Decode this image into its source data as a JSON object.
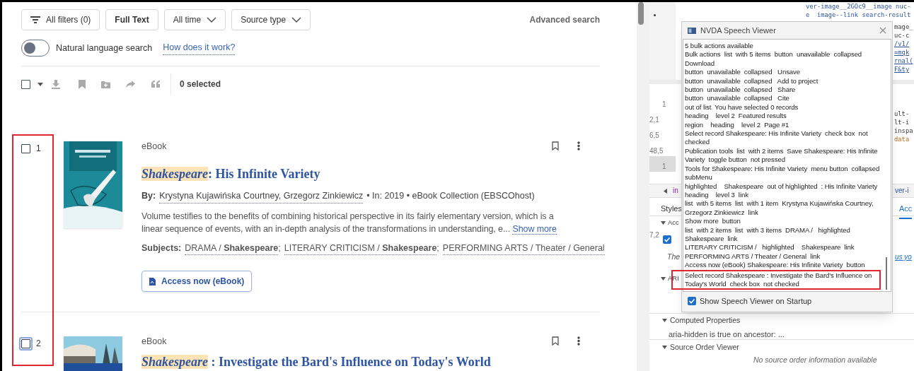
{
  "filters": [
    {
      "label": "All filters (0)",
      "kind": "filter"
    },
    {
      "label": "Full Text",
      "kind": "plain"
    },
    {
      "label": "All time",
      "kind": "dropdown"
    },
    {
      "label": "Source type",
      "kind": "dropdown"
    }
  ],
  "advanced_search": "Advanced search",
  "natural_language": {
    "label": "Natural language search",
    "on": false,
    "link": "How does it work?"
  },
  "bulk_toolbar": {
    "checked": false,
    "selected_count": "0 selected"
  },
  "results": [
    {
      "number": "1",
      "checked": false,
      "focused": false,
      "type": "eBook",
      "title_highlight": "Shakespeare",
      "title_rest": ": His Infinite Variety",
      "byline_label": "By:",
      "authors": "Krystyna Kujawińska Courtney, Grzegorz Zinkiewicz",
      "meta": "• In: 2019 • eBook Collection (EBSCOhost)",
      "abstract": "Volume testifies to the benefits of combining historical perspective in its fairly elementary version, which is a linear sequence of events, with an in-depth analysis of the transformations in understanding, e...",
      "show_more": "Show more",
      "subjects_label": "Subjects:",
      "subject_separator": ";",
      "subjects": [
        "DRAMA / **Shakespeare**",
        "LITERARY CRITICISM / **Shakespeare**",
        "PERFORMING ARTS / Theater / General"
      ],
      "access_button": "Access now (eBook)"
    },
    {
      "number": "2",
      "checked": false,
      "focused": true,
      "type": "eBook",
      "title_highlight": "Shakespeare",
      "title_rest": " : Investigate the Bard's Influence on Today's World"
    }
  ],
  "devtools": {
    "code_lines": [
      "ver-image__2GOc9__image nuc-",
      "e  image--link search-result"
    ],
    "code_fragments": [
      {
        "text": "mage_",
        "kind": "plain"
      },
      {
        "text": "uc-c",
        "kind": "plain"
      },
      {
        "text": "/v1/",
        "kind": "link"
      },
      {
        "text": "=mqk",
        "kind": "link"
      },
      {
        "text": "rnal(",
        "kind": "link"
      },
      {
        "text": "F&ty",
        "kind": "link"
      },
      {
        "text": "ult-",
        "kind": "plain"
      },
      {
        "text": "lt-i",
        "kind": "plain"
      },
      {
        "text": "inspa",
        "kind": "plain"
      },
      {
        "text": "data",
        "kind": "attr"
      }
    ],
    "gutter": [
      "1",
      "2,1",
      "6,5",
      "48,5",
      "1",
      "7,2"
    ],
    "breadcrumb": "in",
    "breadcrumb_tail": "ver-i",
    "tabs": [
      {
        "label": "Styles",
        "selected": false
      },
      {
        "label": "Acc",
        "selected": true
      }
    ],
    "sections": [
      {
        "label": "Acc",
        "expanded": true
      },
      {
        "label": "ARI",
        "expanded": true
      },
      {
        "label": "Computed Properties",
        "expanded": true
      },
      {
        "label": "Source Order Viewer",
        "expanded": true
      }
    ],
    "ignored_checked": true,
    "italic_text": "The",
    "link_fragment": "us yo",
    "computed_note": "aria-hidden is true on ancestor: ...",
    "source_order_note": "No source order information available"
  },
  "speech_viewer": {
    "title": "NVDA Speech Viewer",
    "lines": [
      {
        "text": "5 bulk actions available",
        "annotated": false
      },
      {
        "text": "Bulk actions  list  with 5 items  button  unavailable  collapsed",
        "annotated": false
      },
      {
        "text": "Download",
        "annotated": false
      },
      {
        "text": "button  unavailable  collapsed   Unsave",
        "annotated": false
      },
      {
        "text": "button  unavailable  collapsed   Add to project",
        "annotated": false
      },
      {
        "text": "button  unavailable  collapsed   Share",
        "annotated": false
      },
      {
        "text": "button  unavailable  collapsed   Cite",
        "annotated": false
      },
      {
        "text": "out of list  You have selected 0 records",
        "annotated": false
      },
      {
        "text": "heading    level 2  Featured results",
        "annotated": false
      },
      {
        "text": "region    heading    level 2  Page #1",
        "annotated": false
      },
      {
        "text": "Select record Shakespeare: His Infinite Variety  check box  not checked",
        "annotated": false
      },
      {
        "text": "Publication tools  list  with 2 items  Save Shakespeare: His Infinite Variety  toggle button  not pressed",
        "annotated": false
      },
      {
        "text": "Tools for Shakespeare: His Infinite Variety  menu button  collapsed  subMenu",
        "annotated": false
      },
      {
        "text": "highlighted    Shakespeare  out of highlighted  : His Infinite Variety  heading    level 3  link",
        "annotated": false
      },
      {
        "text": "list  with 5 items  list  with 1 item  Krystyna Kujawińska Courtney, Grzegorz Zinkiewicz  link",
        "annotated": false
      },
      {
        "text": "Show more  button",
        "annotated": false
      },
      {
        "text": "list  with 2 items  list  with 3 items  DRAMA /   highlighted    Shakespeare  link",
        "annotated": false
      },
      {
        "text": "LITERARY CRITICISM /   highlighted    Shakespeare  link",
        "annotated": false
      },
      {
        "text": "PERFORMING ARTS / Theater / General  link",
        "annotated": false
      },
      {
        "text": "Access now (eBook) Shakespeare: His Infinite Variety  button",
        "annotated": false
      },
      {
        "text": "Select record Shakespeare : Investigate the Bard's Influence on Today's World  check box  not checked",
        "annotated": true
      }
    ],
    "startup_label": "Show Speech Viewer on Startup",
    "startup_checked": true
  }
}
